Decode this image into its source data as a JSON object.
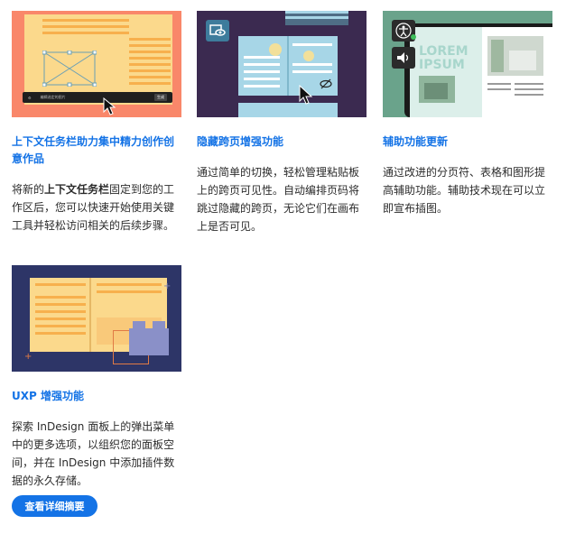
{
  "cards": [
    {
      "title": "上下文任务栏助力集中精力创作创意作品",
      "body_pre": "将新的",
      "body_bold": "上下文任务栏",
      "body_post": "固定到您的工作区后，您可以快速开始使用关键工具并轻松访问相关的后续步骤。",
      "taskbar_text": "编辑选定的图片",
      "taskbar_btn": "生成"
    },
    {
      "title": "隐藏跨页增强功能",
      "body": "通过简单的切换，轻松管理粘贴板上的跨页可见性。自动编排页码将跳过隐藏的跨页，无论它们在画布上是否可见。"
    },
    {
      "title": "辅助功能更新",
      "body": "通过改进的分页符、表格和图形提高辅助功能。辅助技术现在可以立即宣布插图。",
      "lorem_line1": "LOREM",
      "lorem_line2": "IPSUM"
    },
    {
      "title": "UXP 增强功能",
      "body": "探索 InDesign 面板上的弹出菜单中的更多选项，以组织您的面板空间，并在 InDesign 中添加插件数据的永久存储。"
    }
  ],
  "cta_label": "查看详细摘要",
  "colors": {
    "accent": "#1473e6",
    "card1_bg": "#f9876a",
    "card2_bg": "#3b2a50",
    "card3_bg": "#6aa38b",
    "card4_bg": "#2d3567"
  },
  "icons": [
    "cursor-arrow",
    "page-eye-icon",
    "eye-slash-icon",
    "accessibility-person-icon",
    "speaker-icon"
  ]
}
